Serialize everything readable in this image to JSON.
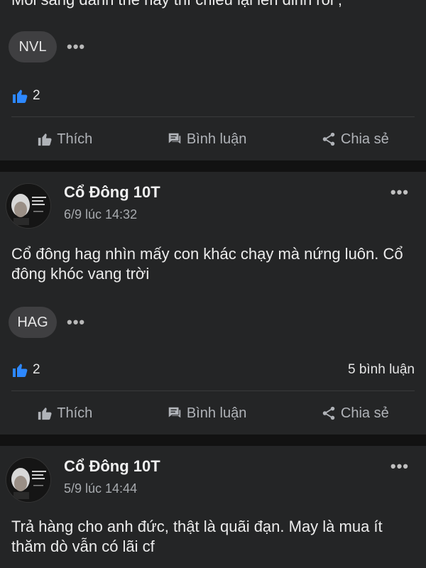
{
  "posts": [
    {
      "text": "Mỗi sáng đánh thế này thì chiều lại lên đỉnh rồi ;",
      "tag": "NVL",
      "likes": "2",
      "comments": "",
      "actions": {
        "like": "Thích",
        "comment": "Bình luận",
        "share": "Chia sẻ"
      }
    },
    {
      "author": "Cổ Đông 10T",
      "time": "6/9 lúc 14:32",
      "text": "Cổ đông hag nhìn mấy con khác chạy mà nứng luôn. Cổ đông khóc vang trời",
      "tag": "HAG",
      "likes": "2",
      "comments": "5 bình luận",
      "actions": {
        "like": "Thích",
        "comment": "Bình luận",
        "share": "Chia sẻ"
      }
    },
    {
      "author": "Cổ Đông 10T",
      "time": "5/9 lúc 14:44",
      "text": "Trả hàng cho anh đức, thật là quãi đạn. May là mua ít thăm dò vẫn có lãi cf"
    }
  ],
  "icons": {
    "like_reaction": "thumbs-up-icon",
    "like": "thumbs-up-outline-icon",
    "comment": "chat-bubble-icon",
    "share": "share-icon",
    "more": "more-dots-icon"
  },
  "colors": {
    "background": "#121212",
    "card": "#242526",
    "like_blue": "#2d88ff",
    "muted": "#b0b3b8"
  }
}
